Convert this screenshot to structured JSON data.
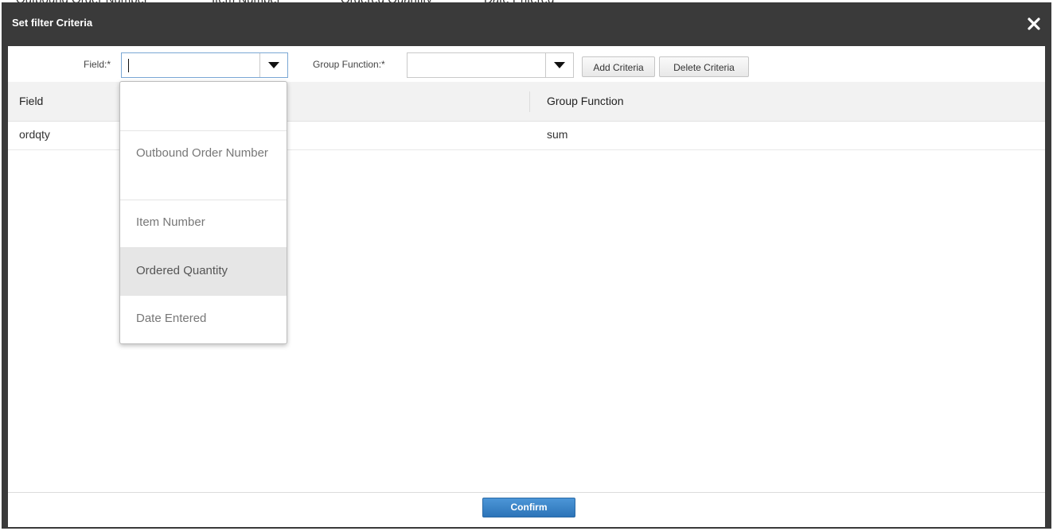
{
  "background_columns": [
    "Outbound Order Number",
    "Item Number",
    "Ordered Quantity",
    "Date Entered"
  ],
  "dialog": {
    "title": "Set filter Criteria",
    "close_icon": "close-icon"
  },
  "toolbar": {
    "field_label": "Field:*",
    "field_value": "",
    "group_function_label": "Group Function:*",
    "group_function_value": "",
    "add_criteria_label": "Add Criteria",
    "delete_criteria_label": "Delete Criteria"
  },
  "grid": {
    "columns": [
      "Field",
      "Group Function"
    ],
    "rows": [
      {
        "field": "ordqty",
        "group_function": "sum"
      }
    ]
  },
  "dropdown": {
    "options": [
      "",
      "Outbound Order Number",
      "Item Number",
      "Ordered Quantity",
      "Date Entered"
    ],
    "highlighted": "Ordered Quantity"
  },
  "footer": {
    "confirm_label": "Confirm"
  },
  "colors": {
    "titlebar": "#3a3a3a",
    "confirm_button": "#3a82c4",
    "highlight_row": "#e6e6e6"
  }
}
